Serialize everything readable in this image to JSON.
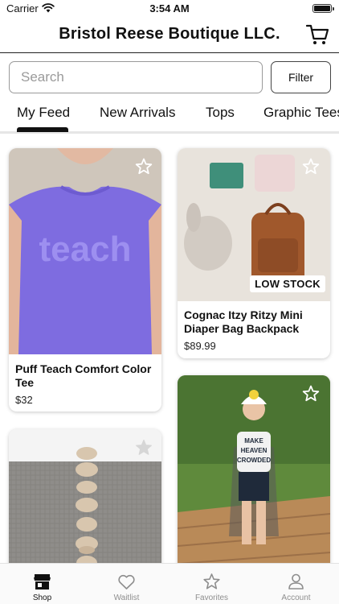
{
  "status_bar": {
    "carrier": "Carrier",
    "time": "3:54 AM"
  },
  "header": {
    "title": "Bristol Reese Boutique LLC.",
    "cart_icon": "shopping-cart-icon"
  },
  "search": {
    "placeholder": "Search",
    "value": ""
  },
  "filter": {
    "label": "Filter"
  },
  "tabs": [
    {
      "label": "My Feed",
      "selected": true
    },
    {
      "label": "New Arrivals",
      "selected": false
    },
    {
      "label": "Tops",
      "selected": false
    },
    {
      "label": "Graphic Tees",
      "selected": false
    }
  ],
  "products": [
    {
      "name": "Puff Teach Comfort Color Tee",
      "price": "$32",
      "image_text": "teach",
      "badge": "",
      "favorited": false
    },
    {
      "name": "Cognac Itzy Ritzy Mini Diaper Bag Backpack",
      "price": "$89.99",
      "badge": "LOW STOCK",
      "favorited": false
    },
    {
      "name": "",
      "price": "",
      "badge": "",
      "favorited": false
    },
    {
      "name": "",
      "price": "",
      "image_text": "MAKE HEAVEN CROWDED",
      "badge": "",
      "favorited": false
    }
  ],
  "bottom_nav": [
    {
      "label": "Shop",
      "icon": "storefront-icon",
      "active": true
    },
    {
      "label": "Waitlist",
      "icon": "heart-icon",
      "active": false
    },
    {
      "label": "Favorites",
      "icon": "star-icon",
      "active": false
    },
    {
      "label": "Account",
      "icon": "person-icon",
      "active": false
    }
  ],
  "colors": {
    "accent": "#111111",
    "tee_purple": "#7E6CE0",
    "inactive": "#8E8E8E",
    "badge_bg": "#FFFFFF"
  }
}
